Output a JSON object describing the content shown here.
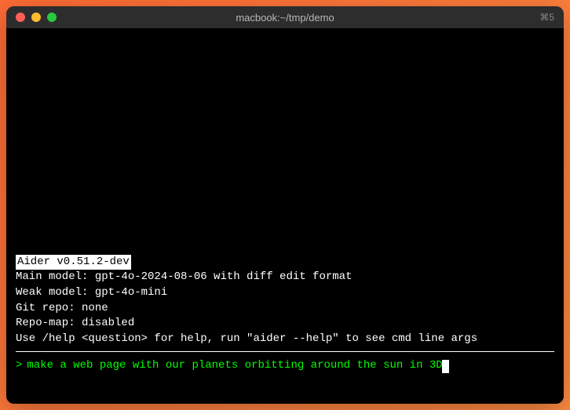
{
  "window": {
    "title": "macbook:~/tmp/demo",
    "shortcut": "⌘5"
  },
  "version_badge": "Aider v0.51.2-dev",
  "output": {
    "main_model": "Main model: gpt-4o-2024-08-06 with diff edit format",
    "weak_model": "Weak model: gpt-4o-mini",
    "git_repo": "Git repo: none",
    "repo_map": "Repo-map: disabled",
    "help_line": "Use /help <question> for help, run \"aider --help\" to see cmd line args"
  },
  "prompt": {
    "symbol": ">",
    "input": "make a web page with our planets orbitting around the sun in 3D"
  }
}
